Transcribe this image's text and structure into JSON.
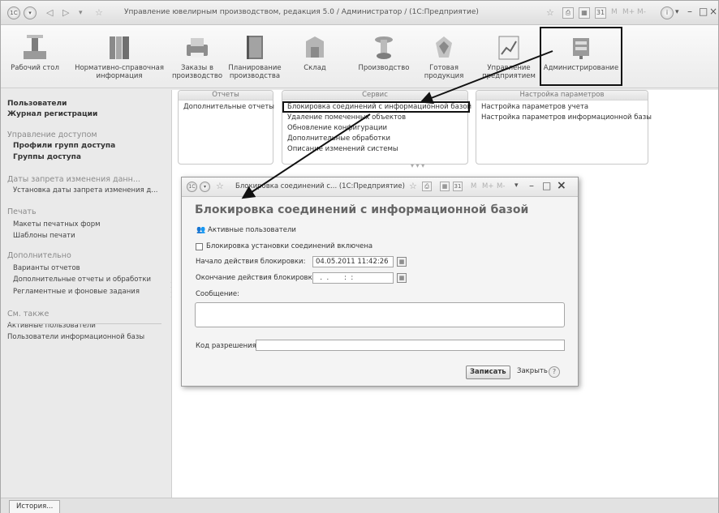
{
  "window": {
    "title": "Управление ювелирным производством, редакция 5.0 / Администратор / (1С:Предприятие)"
  },
  "titlebar": {
    "m_labels": [
      "M",
      "M+",
      "M-"
    ]
  },
  "toolbar": {
    "items": [
      {
        "label": "Рабочий стол",
        "icon": "desktop-icon"
      },
      {
        "label": "Нормативно-справочная информация",
        "icon": "reference-books-icon"
      },
      {
        "label": "Заказы в производство",
        "icon": "printer-orders-icon"
      },
      {
        "label": "Планирование производства",
        "icon": "planning-book-icon"
      },
      {
        "label": "Склад",
        "icon": "warehouse-icon"
      },
      {
        "label": "Производство",
        "icon": "production-icon"
      },
      {
        "label": "Готовая продукция",
        "icon": "finished-products-icon"
      },
      {
        "label": "Управление предприятием",
        "icon": "management-chart-icon"
      },
      {
        "label": "Администрирование",
        "icon": "administration-icon"
      }
    ]
  },
  "sections": {
    "reports": {
      "header": "Отчеты",
      "items": [
        "Дополнительные отчеты"
      ]
    },
    "service": {
      "header": "Сервис",
      "items": [
        "Блокировка соединений с информационной базой",
        "Удаление помеченных объектов",
        "Обновление конфигурации",
        "Дополнительные обработки",
        "Описание изменений системы"
      ]
    },
    "settings": {
      "header": "Настройка параметров",
      "items": [
        "Настройка параметров учета",
        "Настройка параметров информационной базы"
      ]
    }
  },
  "left": {
    "users": "Пользователи",
    "journal": "Журнал регистрации",
    "access_header": "Управление доступом",
    "access_profiles": "Профили групп доступа",
    "access_groups": "Группы доступа",
    "dates_header": "Даты запрета изменения данн...",
    "dates_item": "Установка даты запрета изменения д...",
    "print_header": "Печать",
    "print_layouts": "Макеты печатных форм",
    "print_templates": "Шаблоны печати",
    "extra_header": "Дополнительно",
    "extra_variants": "Варианты отчетов",
    "extra_reports": "Дополнительные отчеты и обработки",
    "extra_tasks": "Регламентные и фоновые задания",
    "see_also_header": "См. также",
    "see_active": "Активные пользователи",
    "see_ib_users": "Пользователи информационной базы"
  },
  "bottom": {
    "history": "История..."
  },
  "dialog": {
    "window_title": "Блокировка соединений с...  (1С:Предприятие)",
    "heading": "Блокировка соединений с информационной базой",
    "active_users": "Активные пользователи",
    "checkbox_label": "Блокировка установки соединений включена",
    "start_label": "Начало действия блокировки:",
    "start_value": "04.05.2011 11:42:26",
    "end_label": "Окончание действия блокировки:",
    "end_value": "  .  .       :  :  ",
    "message_label": "Сообщение:",
    "message_value": "",
    "code_label": "Код разрешения:",
    "code_value": "",
    "save": "Записать",
    "close": "Закрыть",
    "help": "?"
  }
}
